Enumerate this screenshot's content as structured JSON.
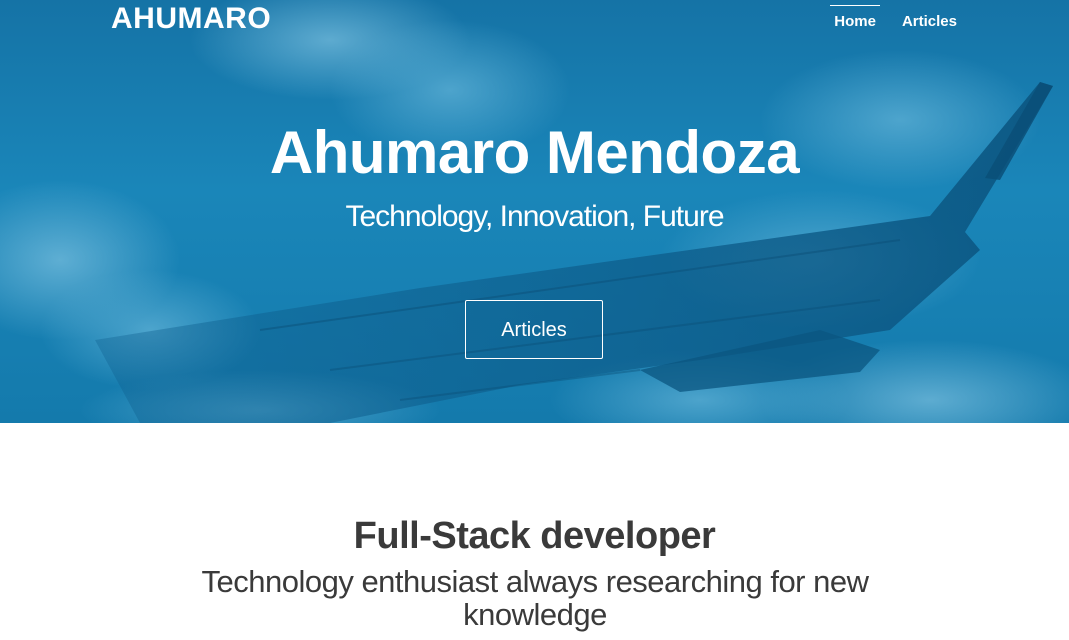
{
  "navbar": {
    "brand": "AHUMARO",
    "items": [
      {
        "label": "Home",
        "active": true
      },
      {
        "label": "Articles",
        "active": false
      }
    ]
  },
  "hero": {
    "title": "Ahumaro Mendoza",
    "subtitle": "Technology, Innovation, Future",
    "button_label": "Articles",
    "overlay_color": "#1a86b9"
  },
  "about": {
    "title": "Full-Stack developer",
    "text": "Technology enthusiast always researching for new knowledge"
  },
  "colors": {
    "text_dark": "#3a3a3a",
    "white": "#ffffff"
  }
}
